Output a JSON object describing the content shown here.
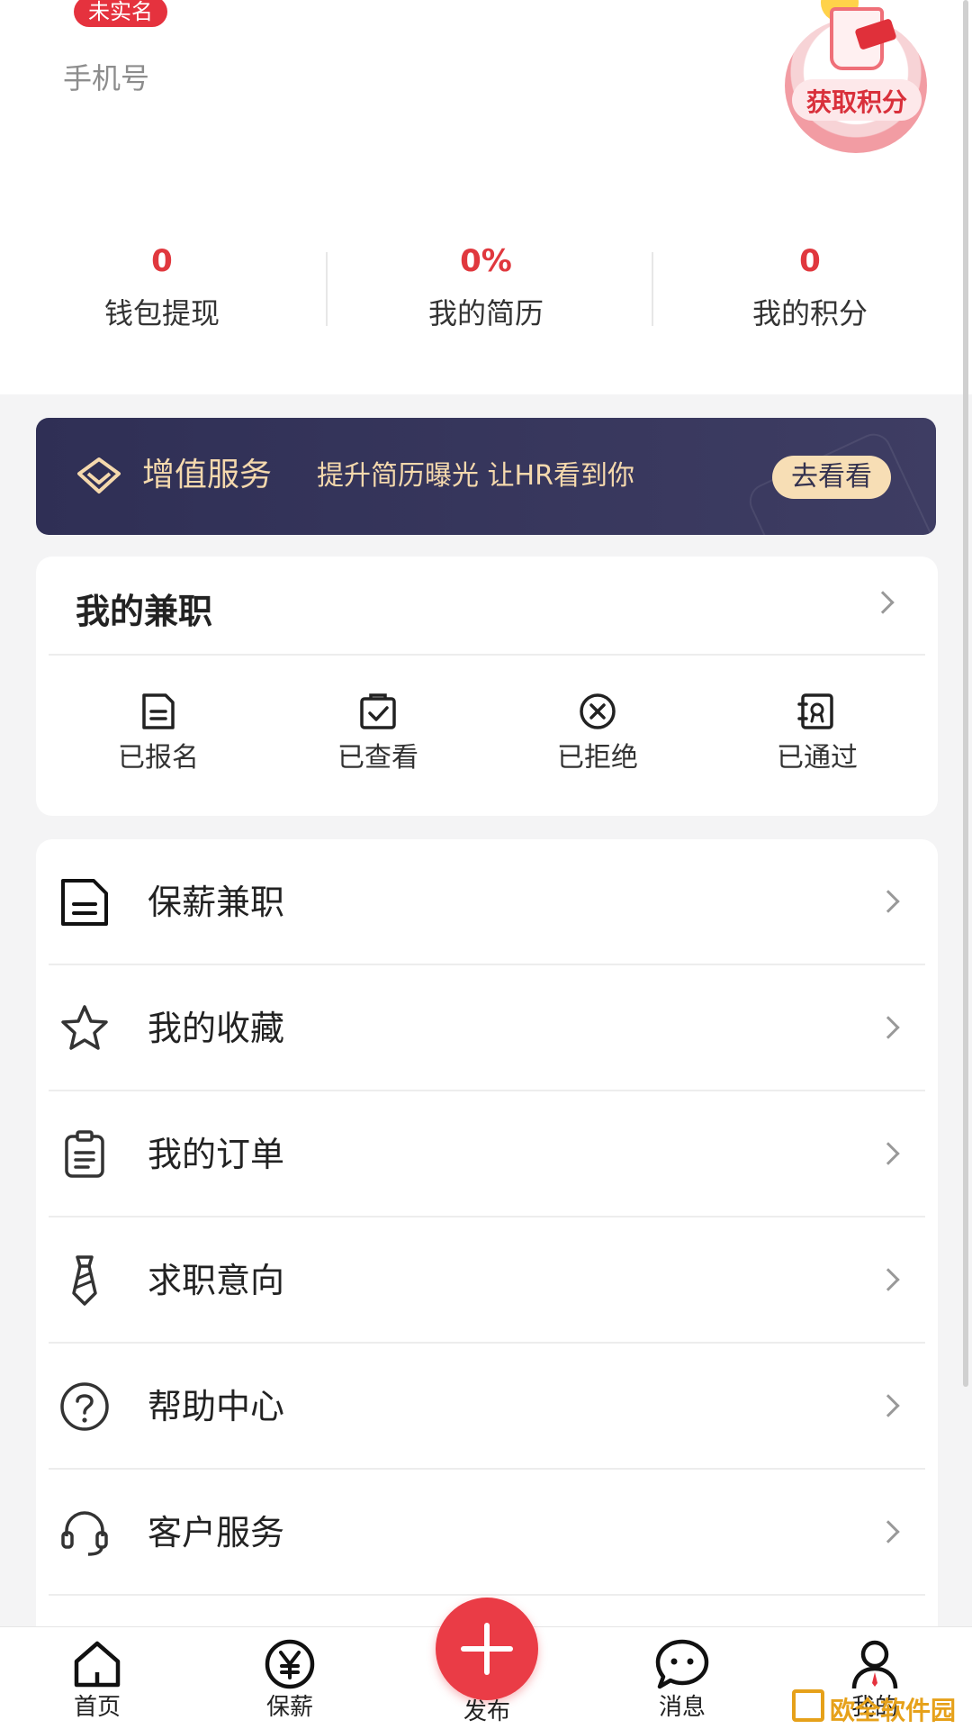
{
  "profile": {
    "verify_badge": "未实名",
    "phone_label": "手机号",
    "points_button": "获取积分"
  },
  "stats": [
    {
      "value": "0",
      "label": "钱包提现"
    },
    {
      "value": "0%",
      "label": "我的简历"
    },
    {
      "value": "0",
      "label": "我的积分"
    }
  ],
  "banner": {
    "title": "增值服务",
    "subtitle": "提升简历曝光 让HR看到你",
    "button": "去看看"
  },
  "parttime": {
    "title": "我的兼职",
    "statuses": [
      {
        "label": "已报名",
        "icon": "document-icon"
      },
      {
        "label": "已查看",
        "icon": "clipboard-check-icon"
      },
      {
        "label": "已拒绝",
        "icon": "circle-x-icon"
      },
      {
        "label": "已通过",
        "icon": "certificate-icon"
      }
    ]
  },
  "menu": [
    {
      "label": "保薪兼职",
      "icon": "document-icon"
    },
    {
      "label": "我的收藏",
      "icon": "star-icon"
    },
    {
      "label": "我的订单",
      "icon": "clipboard-icon"
    },
    {
      "label": "求职意向",
      "icon": "tie-icon"
    },
    {
      "label": "帮助中心",
      "icon": "question-icon"
    },
    {
      "label": "客户服务",
      "icon": "headset-icon"
    }
  ],
  "tabbar": [
    {
      "label": "首页",
      "icon": "home-icon"
    },
    {
      "label": "保薪",
      "icon": "yen-icon"
    },
    {
      "label": "发布",
      "icon": "plus-icon"
    },
    {
      "label": "消息",
      "icon": "chat-icon"
    },
    {
      "label": "我的",
      "icon": "user-icon"
    }
  ],
  "watermark": "欧全软件园",
  "colors": {
    "accent": "#e5323e",
    "banner_bg": "#2f2f55",
    "banner_text": "#f5d9ad"
  }
}
